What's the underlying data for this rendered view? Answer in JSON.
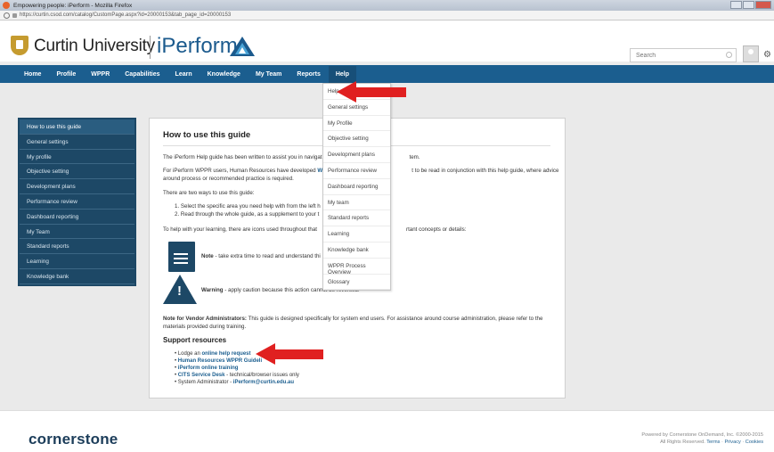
{
  "browser": {
    "window_title": "Empowering people: iPerform - Mozilla Firefox",
    "url": "https://curtin.csod.com/catalog/CustomPage.aspx?id=20000153&tab_page_id=20000153"
  },
  "header": {
    "university_name": "Curtin University",
    "app_name": "iPerform",
    "search_placeholder": "Search",
    "colors": {
      "brand_blue": "#1b5e8f",
      "nav_dark": "#1d4866",
      "shield_gold": "#c59b2f",
      "arrow_red": "#e02020"
    }
  },
  "nav": {
    "items": [
      "Home",
      "Profile",
      "WPPR",
      "Capabilities",
      "Learn",
      "Knowledge",
      "My Team",
      "Reports",
      "Help"
    ],
    "active": "Help"
  },
  "help_menu": {
    "items": [
      "Help",
      "General settings",
      "My Profile",
      "Objective setting",
      "Development plans",
      "Performance review",
      "Dashboard reporting",
      "My team",
      "Standard reports",
      "Learning",
      "Knowledge bank",
      "WPPR Process Overview",
      "Glossary"
    ]
  },
  "sidebar": {
    "items": [
      "How to use this guide",
      "General settings",
      "My profile",
      "Objective setting",
      "Development plans",
      "Performance review",
      "Dashboard reporting",
      "My Team",
      "Standard reports",
      "Learning",
      "Knowledge bank"
    ],
    "selected": "How to use this guide"
  },
  "main": {
    "title": "How to use this guide",
    "p1": "The iPerform Help guide has been written to assist you in navigat",
    "p1_tail": "tem.",
    "p2_a": "For iPerform WPPR users, Human Resources have developed ",
    "p2_link": "WP",
    "p2_b": "t to be read in conjunction with this help guide, where advice",
    "p2_line2": "around process or recommended practice is required.",
    "p3": "There are two ways to use this guide:",
    "li1": "1. Select the specific area you need help with from the left h",
    "li2": "2. Read through the whole guide, as a supplement to your t",
    "p4_a": "To help with your learning, there are icons used throughout that",
    "p4_b": "rtant concepts or details:",
    "note_label": "Note",
    "note_text": " - take extra time to read and understand thi",
    "warning_label": "Warning",
    "warning_text": " - apply caution because this action cannot be reversed.",
    "vendor_label": "Note for Vendor Administrators:",
    "vendor_text": " This guide is designed specifically for system end users. For assistance around course administration, please refer to the",
    "vendor_line2": "materials provided during training.",
    "support_title": "Support resources",
    "support": [
      {
        "prefix": "Lodge an ",
        "link": "online help request",
        "suffix": ""
      },
      {
        "prefix": "",
        "link": "Human Resources WPPR Guideli",
        "suffix": ""
      },
      {
        "prefix": "",
        "link": "iPerform online training",
        "suffix": ""
      },
      {
        "prefix": "",
        "link": "CITS Service Desk",
        "suffix": " - technical/browser issues only"
      },
      {
        "prefix": "System Administrator - ",
        "link": "iPerform@curtin.edu.au",
        "suffix": ""
      }
    ]
  },
  "footer": {
    "brand": "cornerstone",
    "copyright": "Powered by Cornerstone OnDemand, Inc. ©2000-2015",
    "rights": "All Rights Reserved.",
    "terms": "Terms",
    "privacy": "Privacy",
    "cookies": "Cookies"
  }
}
